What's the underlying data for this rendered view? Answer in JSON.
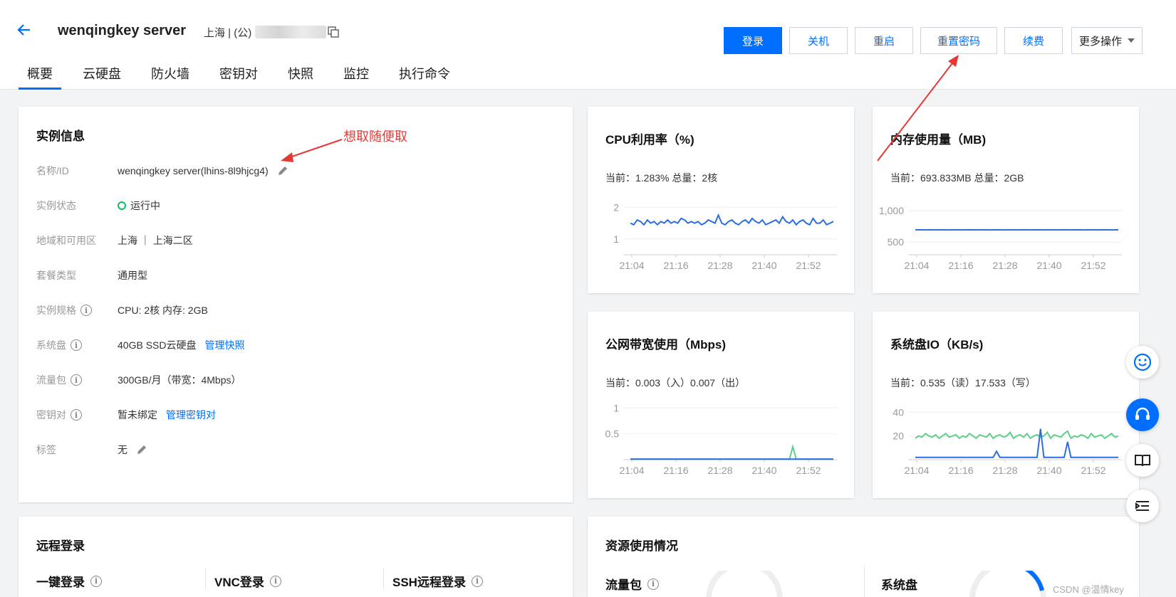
{
  "header": {
    "title": "wenqingkey server",
    "region": "上海 | (公)",
    "buttons": {
      "login": "登录",
      "shutdown": "关机",
      "restart": "重启",
      "reset_password": "重置密码",
      "renew": "续费",
      "more": "更多操作"
    }
  },
  "tabs": [
    "概要",
    "云硬盘",
    "防火墙",
    "密钥对",
    "快照",
    "监控",
    "执行命令"
  ],
  "annotation": "想取随便取",
  "instance_info": {
    "title": "实例信息",
    "rows": {
      "name": {
        "label": "名称/ID",
        "value": "wenqingkey server(lhins-8l9hjcg4)"
      },
      "status": {
        "label": "实例状态",
        "value": "运行中"
      },
      "region": {
        "label": "地域和可用区",
        "value": "上海 ｜ 上海二区"
      },
      "package": {
        "label": "套餐类型",
        "value": "通用型"
      },
      "spec": {
        "label": "实例规格",
        "value": "CPU: 2核 内存: 2GB"
      },
      "disk": {
        "label": "系统盘",
        "value": "40GB SSD云硬盘",
        "link": "管理快照"
      },
      "traffic": {
        "label": "流量包",
        "value": "300GB/月（带宽：4Mbps）"
      },
      "keypair": {
        "label": "密钥对",
        "value": "暂未绑定",
        "link": "管理密钥对"
      },
      "tags": {
        "label": "标签",
        "value": "无"
      }
    }
  },
  "colors": {
    "accent": "#006eff",
    "line_blue": "#2b6de0",
    "line_green": "#5fd08a",
    "status_green": "#0abf5b",
    "annotation_red": "#e53935"
  },
  "x_ticks": [
    "21:04",
    "21:16",
    "21:28",
    "21:40",
    "21:52"
  ],
  "chart_data": [
    {
      "type": "line",
      "title": "CPU利用率（%)",
      "current": "当前：1.283% 总量：2核",
      "ylim": [
        0.5,
        2.3
      ],
      "yticks": [
        "2",
        "1"
      ],
      "ytick_values": [
        2,
        1
      ],
      "series": [
        {
          "color": "#2b6de0",
          "values": [
            1.5,
            1.45,
            1.6,
            1.55,
            1.45,
            1.6,
            1.5,
            1.55,
            1.45,
            1.55,
            1.5,
            1.6,
            1.5,
            1.55,
            1.5,
            1.65,
            1.6,
            1.5,
            1.55,
            1.5,
            1.55,
            1.45,
            1.5,
            1.6,
            1.55,
            1.5,
            1.75,
            1.5,
            1.45,
            1.55,
            1.6,
            1.5,
            1.45,
            1.55,
            1.6,
            1.5,
            1.65,
            1.55,
            1.5,
            1.6,
            1.45,
            1.5,
            1.55,
            1.6,
            1.5,
            1.7,
            1.55,
            1.5,
            1.6,
            1.45,
            1.55,
            1.6,
            1.5,
            1.45,
            1.65,
            1.5,
            1.5,
            1.6,
            1.45,
            1.5,
            1.55
          ]
        }
      ]
    },
    {
      "type": "line",
      "title": "内存使用量（MB)",
      "current": "当前：693.833MB 总量：2GB",
      "ylim": [
        300,
        1200
      ],
      "yticks": [
        "1,000",
        "500"
      ],
      "ytick_values": [
        1000,
        500
      ],
      "series": [
        {
          "color": "#2b6de0",
          "values": [
            695,
            694,
            694,
            693,
            694,
            694,
            693,
            694,
            694,
            694,
            693,
            694,
            694,
            694,
            693,
            694,
            694,
            694,
            693,
            694,
            694,
            694,
            693,
            694,
            694,
            694,
            693,
            694,
            694,
            694,
            693,
            694,
            694,
            694,
            693,
            694,
            694,
            694,
            693,
            694,
            694,
            694,
            693,
            694,
            694,
            694,
            693,
            694,
            694,
            694,
            693,
            694,
            694,
            694,
            693,
            694,
            694,
            694,
            693,
            694,
            694
          ]
        }
      ]
    },
    {
      "type": "line",
      "title": "公网带宽使用（Mbps)",
      "current": "当前：0.003（入）0.007（出）",
      "ylim": [
        0,
        1.1
      ],
      "yticks": [
        "1",
        "0.5"
      ],
      "ytick_values": [
        1,
        0.5
      ],
      "series": [
        {
          "color": "#5fd08a",
          "values": [
            0.01,
            0.01,
            0.01,
            0.01,
            0.01,
            0.01,
            0.01,
            0.01,
            0.01,
            0.01,
            0.01,
            0.01,
            0.01,
            0.01,
            0.01,
            0.01,
            0.01,
            0.01,
            0.01,
            0.01,
            0.01,
            0.01,
            0.01,
            0.01,
            0.01,
            0.01,
            0.01,
            0.01,
            0.01,
            0.01,
            0.01,
            0.01,
            0.01,
            0.01,
            0.01,
            0.01,
            0.01,
            0.01,
            0.01,
            0.01,
            0.01,
            0.01,
            0.01,
            0.01,
            0.01,
            0.01,
            0.01,
            0.01,
            0.25,
            0.01,
            0.01,
            0.01,
            0.01,
            0.01,
            0.01,
            0.01,
            0.01,
            0.01,
            0.01,
            0.01,
            0.01
          ]
        },
        {
          "color": "#2b6de0",
          "values": [
            0.01,
            0.01,
            0.01,
            0.01,
            0.01,
            0.01,
            0.01,
            0.01,
            0.01,
            0.01,
            0.01,
            0.01,
            0.01,
            0.01,
            0.01,
            0.01,
            0.01,
            0.01,
            0.01,
            0.01,
            0.01,
            0.01,
            0.01,
            0.01,
            0.01,
            0.01,
            0.01,
            0.01,
            0.01,
            0.01,
            0.01,
            0.01,
            0.01,
            0.01,
            0.01,
            0.01,
            0.01,
            0.01,
            0.01,
            0.01,
            0.01,
            0.01,
            0.01,
            0.01,
            0.01,
            0.01,
            0.01,
            0.01,
            0.01,
            0.01,
            0.01,
            0.01,
            0.01,
            0.01,
            0.01,
            0.01,
            0.01,
            0.01,
            0.01,
            0.01,
            0.01
          ]
        }
      ]
    },
    {
      "type": "line",
      "title": "系统盘IO（KB/s)",
      "current": "当前：0.535（读）17.533（写）",
      "ylim": [
        0,
        48
      ],
      "yticks": [
        "40",
        "20"
      ],
      "ytick_values": [
        40,
        20
      ],
      "series": [
        {
          "color": "#5fd08a",
          "values": [
            18,
            20,
            19,
            22,
            20,
            19,
            21,
            18,
            20,
            22,
            19,
            20,
            21,
            18,
            20,
            19,
            22,
            20,
            18,
            21,
            20,
            19,
            22,
            18,
            20,
            21,
            19,
            20,
            23,
            18,
            20,
            21,
            19,
            22,
            18,
            20,
            21,
            19,
            20,
            23,
            18,
            21,
            20,
            19,
            22,
            24,
            18,
            20,
            19,
            21,
            20,
            18,
            22,
            19,
            20,
            21,
            18,
            20,
            22,
            19,
            20
          ]
        },
        {
          "color": "#2b6de0",
          "values": [
            2,
            2,
            2,
            2,
            2,
            2,
            2,
            2,
            2,
            2,
            2,
            2,
            2,
            2,
            2,
            2,
            2,
            2,
            2,
            2,
            2,
            2,
            2,
            2,
            7,
            2,
            2,
            2,
            2,
            2,
            2,
            2,
            2,
            2,
            2,
            2,
            2,
            26,
            2,
            2,
            2,
            2,
            2,
            2,
            2,
            15,
            2,
            2,
            2,
            2,
            2,
            2,
            2,
            2,
            2,
            2,
            2,
            2,
            2,
            2,
            2
          ]
        }
      ]
    }
  ],
  "remote_login": {
    "title": "远程登录",
    "one_click": "一键登录",
    "vnc": "VNC登录",
    "ssh": "SSH远程登录"
  },
  "resource_usage": {
    "title": "资源使用情况",
    "traffic": "流量包",
    "system_disk": "系统盘"
  },
  "watermark": "CSDN @温情key"
}
